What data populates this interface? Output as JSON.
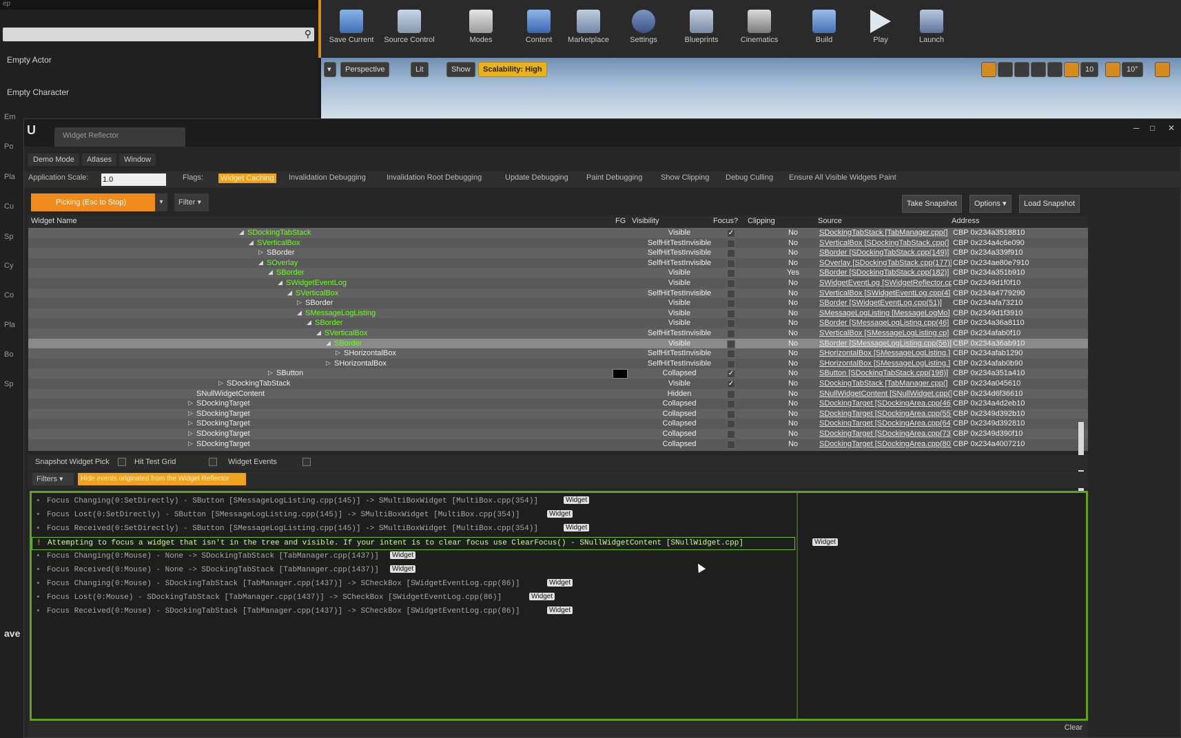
{
  "left_panel": {
    "top_text": "ep",
    "items": [
      "Empty Actor",
      "Empty Character"
    ],
    "side_letters": [
      "Em",
      "Po",
      "Pla",
      "Cu",
      "Sp",
      "Cy",
      "Co",
      "Pla",
      "Bo",
      "Sp"
    ],
    "save_text": "ave"
  },
  "toolbar": {
    "buttons": [
      "Save Current",
      "Source Control",
      "Modes",
      "Content",
      "Marketplace",
      "Settings",
      "Blueprints",
      "Cinematics",
      "Build",
      "Play",
      "Launch"
    ]
  },
  "viewport": {
    "buttons": [
      "Perspective",
      "Lit",
      "Show",
      "Scalability: High"
    ],
    "snap_values": [
      "10",
      "10°"
    ]
  },
  "reflector": {
    "title": "Widget Reflector",
    "menu": [
      "Demo Mode",
      "Atlases",
      "Window"
    ],
    "app_scale_label": "Application Scale:",
    "app_scale_value": "1.0",
    "flags_label": "Flags:",
    "flags": [
      "Widget Caching",
      "Invalidation Debugging",
      "Invalidation Root Debugging",
      "Update Debugging",
      "Paint Debugging",
      "Show Clipping",
      "Debug Culling",
      "Ensure All Visible Widgets Paint"
    ],
    "picking_label": "Picking (Esc to Stop)",
    "filter_label": "Filter",
    "take_snapshot": "Take Snapshot",
    "options": "Options",
    "load_snapshot": "Load Snapshot",
    "columns": {
      "name": "Widget Name",
      "fg": "FG",
      "visibility": "Visibility",
      "focus": "Focus?",
      "clipping": "Clipping",
      "source": "Source",
      "address": "Address"
    },
    "rows": [
      {
        "name": "SDockingTabStack",
        "vis": "Visible",
        "focus": true,
        "clip": "No",
        "src": "SDockingTabStack [TabManager.cpp(]",
        "addr": "CBP 0x234a3518810"
      },
      {
        "name": "SVerticalBox",
        "vis": "SelfHitTestInvisible",
        "focus": false,
        "clip": "No",
        "src": "SVerticalBox [SDockingTabStack.cpp(]",
        "addr": "CBP 0x234a4c6e090"
      },
      {
        "name": "SBorder",
        "vis": "SelfHitTestInvisible",
        "focus": false,
        "clip": "No",
        "src": "SBorder [SDockingTabStack.cpp(149)]",
        "addr": "CBP 0x234a339f910"
      },
      {
        "name": "SOverlay",
        "vis": "SelfHitTestInvisible",
        "focus": false,
        "clip": "No",
        "src": "SOverlay [SDockingTabStack.cpp(177)]",
        "addr": "CBP 0x234ae80e7910"
      },
      {
        "name": "SBorder",
        "vis": "Visible",
        "focus": false,
        "clip": "Yes",
        "src": "SBorder [SDockingTabStack.cpp(182)]",
        "addr": "CBP 0x234a351b910"
      },
      {
        "name": "SWidgetEventLog",
        "vis": "Visible",
        "focus": false,
        "clip": "No",
        "src": "SWidgetEventLog [SWidgetReflector.cp]",
        "addr": "CBP 0x2349d1f0f10"
      },
      {
        "name": "SVerticalBox",
        "vis": "SelfHitTestInvisible",
        "focus": false,
        "clip": "No",
        "src": "SVerticalBox [SWidgetEventLog.cpp(4]",
        "addr": "CBP 0x234a4779290"
      },
      {
        "name": "SBorder",
        "vis": "Visible",
        "focus": false,
        "clip": "No",
        "src": "SBorder [SWidgetEventLog.cpp(51)]",
        "addr": "CBP 0x234afa73210"
      },
      {
        "name": "SMessageLogListing",
        "vis": "Visible",
        "focus": false,
        "clip": "No",
        "src": "SMessageLogListing [MessageLogMo]",
        "addr": "CBP 0x2349d1f3910"
      },
      {
        "name": "SBorder",
        "vis": "Visible",
        "focus": false,
        "clip": "No",
        "src": "SBorder [SMessageLogListing.cpp(46]",
        "addr": "CBP 0x234a36a8110"
      },
      {
        "name": "SVerticalBox",
        "vis": "SelfHitTestInvisible",
        "focus": false,
        "clip": "No",
        "src": "SVerticalBox [SMessageLogListing.cp]",
        "addr": "CBP 0x234afab0f10"
      },
      {
        "name": "SBorder",
        "vis": "Visible",
        "focus": false,
        "clip": "No",
        "src": "SBorder [SMessageLogListing.cpp(56)]",
        "addr": "CBP 0x234a36ab910"
      },
      {
        "name": "SHorizontalBox",
        "vis": "SelfHitTestInvisible",
        "focus": false,
        "clip": "No",
        "src": "SHorizontalBox [SMessageLogListing.]",
        "addr": "CBP 0x234afab1290"
      },
      {
        "name": "SHorizontalBox",
        "vis": "SelfHitTestInvisible",
        "focus": false,
        "clip": "No",
        "src": "SHorizontalBox [SMessageLogListing.]",
        "addr": "CBP 0x234afab0b90"
      },
      {
        "name": "SButton",
        "vis": "Collapsed",
        "focus": true,
        "clip": "No",
        "src": "SButton [SDockingTabStack.cpp(198)]",
        "addr": "CBP 0x234a351a410"
      },
      {
        "name": "SDockingTabStack",
        "vis": "Visible",
        "focus": true,
        "clip": "No",
        "src": "SDockingTabStack [TabManager.cpp(]",
        "addr": "CBP 0x234a045610"
      },
      {
        "name": "SNullWidgetContent",
        "vis": "Hidden",
        "focus": false,
        "clip": "No",
        "src": "SNullWidgetContent [SNullWidget.cpp(]",
        "addr": "CBP 0x234d6f36610"
      },
      {
        "name": "SDockingTarget",
        "vis": "Collapsed",
        "focus": false,
        "clip": "No",
        "src": "SDockingTarget [SDockingArea.cpp(46]",
        "addr": "CBP 0x234a4d2eb10"
      },
      {
        "name": "SDockingTarget",
        "vis": "Collapsed",
        "focus": false,
        "clip": "No",
        "src": "SDockingTarget [SDockingArea.cpp(55]",
        "addr": "CBP 0x2349d392b10"
      },
      {
        "name": "SDockingTarget",
        "vis": "Collapsed",
        "focus": false,
        "clip": "No",
        "src": "SDockingTarget [SDockingArea.cpp(64]",
        "addr": "CBP 0x2349d392810"
      },
      {
        "name": "SDockingTarget",
        "vis": "Collapsed",
        "focus": false,
        "clip": "No",
        "src": "SDockingTarget [SDockingArea.cpp(73]",
        "addr": "CBP 0x2349d390f10"
      },
      {
        "name": "SDockingTarget",
        "vis": "Collapsed",
        "focus": false,
        "clip": "No",
        "src": "SDockingTarget [SDockingArea.cpp(80]",
        "addr": "CBP 0x234a4007210"
      }
    ],
    "snapshot_pick": "Snapshot Widget Pick",
    "hit_test_grid": "Hit Test Grid",
    "widget_events": "Widget Events",
    "filters": "Filters",
    "hide_events": "Hide events originated from the Widget Reflector",
    "widget_link": "Widget",
    "log": [
      "Focus Changing(0:SetDirectly) - SButton [SMessageLogListing.cpp(145)] -> SMultiBoxWidget [MultiBox.cpp(354)]",
      "Focus Lost(0:SetDirectly) - SButton [SMessageLogListing.cpp(145)] -> SMultiBoxWidget [MultiBox.cpp(354)]",
      "Focus Received(0:SetDirectly) - SButton [SMessageLogListing.cpp(145)] -> SMultiBoxWidget [MultiBox.cpp(354)]",
      "Attempting to focus a widget that isn't in the tree and visible. If your intent is to clear focus use ClearFocus() - SNullWidgetContent [SNullWidget.cpp]",
      "Focus Changing(0:Mouse) - None -> SDockingTabStack [TabManager.cpp(1437)]",
      "Focus Received(0:Mouse) - None -> SDockingTabStack [TabManager.cpp(1437)]",
      "Focus Changing(0:Mouse) - SDockingTabStack [TabManager.cpp(1437)] -> SCheckBox [SWidgetEventLog.cpp(86)]",
      "Focus Lost(0:Mouse) - SDockingTabStack [TabManager.cpp(1437)] -> SCheckBox [SWidgetEventLog.cpp(86)]",
      "Focus Received(0:Mouse) - SDockingTabStack [TabManager.cpp(1437)] -> SCheckBox [SWidgetEventLog.cpp(86)]"
    ],
    "clear": "Clear"
  }
}
